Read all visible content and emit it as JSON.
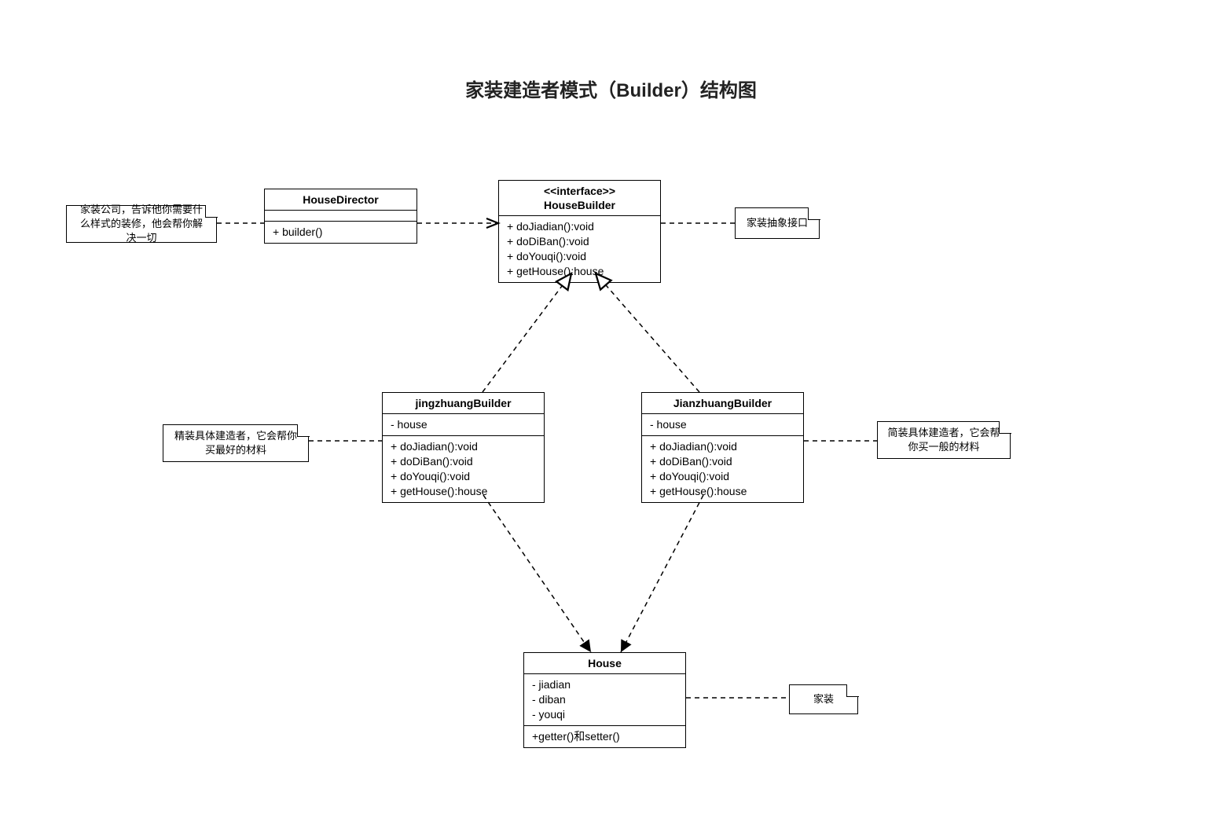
{
  "title": "家装建造者模式（Builder）结构图",
  "classes": {
    "director": {
      "name": "HouseDirector",
      "methods": "+ builder()"
    },
    "builder": {
      "stereotype": "<<interface>>",
      "name": "HouseBuilder",
      "methods": "+ doJiadian():void\n+ doDiBan():void\n+ doYouqi():void\n+ getHouse():house"
    },
    "jing": {
      "name": "jingzhuangBuilder",
      "attrs": "- house",
      "methods": "+ doJiadian():void\n+ doDiBan():void\n+ doYouqi():void\n+ getHouse():house"
    },
    "jian": {
      "name": "JianzhuangBuilder",
      "attrs": "- house",
      "methods": "+ doJiadian():void\n+ doDiBan():void\n+ doYouqi():void\n+ getHouse():house"
    },
    "house": {
      "name": "House",
      "attrs": "- jiadian\n- diban\n- youqi",
      "methods": "+getter()和setter()"
    }
  },
  "notes": {
    "director": "家装公司，告诉他你需要什么样式的装修，他会帮你解决一切",
    "builder": "家装抽象接口",
    "jing": "精装具体建造者，它会帮你买最好的材料",
    "jian": "简装具体建造者，它会帮你买一般的材料",
    "house": "家装"
  }
}
